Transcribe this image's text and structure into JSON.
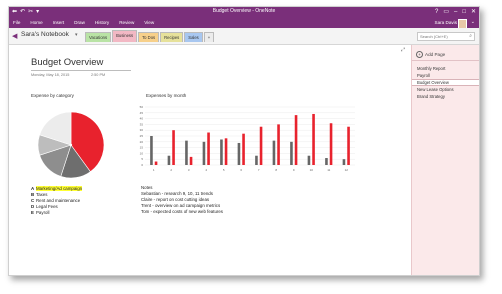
{
  "window": {
    "title": "Budget Overview - OneNote",
    "quick_access": [
      "⬅",
      "↶",
      "✂",
      "▾"
    ],
    "controls": [
      "?",
      "▭",
      "–",
      "□",
      "✕"
    ]
  },
  "ribbon": {
    "tabs": [
      "File",
      "Home",
      "Insert",
      "Draw",
      "History",
      "Review",
      "View"
    ],
    "user": "Sara Davis",
    "caret": "⌄"
  },
  "navbar": {
    "back_icon": "◀",
    "notebook": "Sara's Notebook",
    "notebook_caret": "▾",
    "sections": [
      {
        "label": "Vacations",
        "color": "#b9e3a5"
      },
      {
        "label": "Business",
        "color": "#f2b8c4",
        "active": true
      },
      {
        "label": "To Dos",
        "color": "#f7d08a"
      },
      {
        "label": "Recipes",
        "color": "#e6e19a"
      },
      {
        "label": "Sales",
        "color": "#a8c7f0"
      },
      {
        "label": "+",
        "color": "#ececec"
      }
    ],
    "search_placeholder": "Search (Ctrl+E)",
    "search_icon": "⌕"
  },
  "page": {
    "title": "Budget Overview",
    "date": "Monday, May 18, 2015",
    "time": "2:50 PM",
    "expand_icon": "⤢",
    "pie_title": "Expense by category",
    "bars_title": "Expenses by month",
    "categories": [
      {
        "marker": "A",
        "label": "Marketing/Ad campaign",
        "highlight": true
      },
      {
        "marker": "B",
        "label": "Taxes"
      },
      {
        "marker": "C",
        "label": "Rent and maintenance"
      },
      {
        "marker": "D",
        "label": "Legal Fees"
      },
      {
        "marker": "E",
        "label": "Payroll"
      }
    ],
    "notes": [
      "Notes",
      "Sebastian - research 9, 10, 11 trends",
      "Claire - report on cost cutting ideas",
      "Trent - overview on ad campaign metrics",
      "Tom - expected costs of new web features"
    ]
  },
  "pages_pane": {
    "add_label": "Add Page",
    "pages": [
      {
        "label": "Monthly Report"
      },
      {
        "label": "Payroll"
      },
      {
        "label": "Budget Overview",
        "selected": true
      },
      {
        "label": "New Lease Options"
      },
      {
        "label": "Brand Strategy"
      }
    ]
  },
  "chart_data": [
    {
      "type": "pie",
      "title": "Expense by category",
      "categories": [
        "Marketing/Ad campaign",
        "Taxes",
        "Rent and maintenance",
        "Legal Fees",
        "Payroll"
      ],
      "values": [
        40,
        15,
        15,
        10,
        20
      ],
      "colors": [
        "#e8222d",
        "#6e6e6e",
        "#8e8e8e",
        "#bdbdbd",
        "#ececec"
      ]
    },
    {
      "type": "bar",
      "title": "Expenses by month",
      "categories": [
        "1",
        "2",
        "3",
        "4",
        "5",
        "6",
        "7",
        "8",
        "9",
        "10",
        "11",
        "12"
      ],
      "ylim": [
        0,
        50
      ],
      "y_ticks": [
        "50",
        "45",
        "40",
        "35",
        "30",
        "25",
        "20",
        "15",
        "10",
        "5",
        "0"
      ],
      "grid": true,
      "series": [
        {
          "values": [
            25,
            8,
            21,
            20,
            22,
            19,
            8,
            21,
            20,
            8,
            6,
            5
          ],
          "color": "#666666"
        },
        {
          "values": [
            3,
            30,
            7,
            28,
            23,
            27,
            33,
            35,
            43,
            44,
            36,
            33
          ],
          "color": "#e8222d"
        }
      ]
    }
  ]
}
